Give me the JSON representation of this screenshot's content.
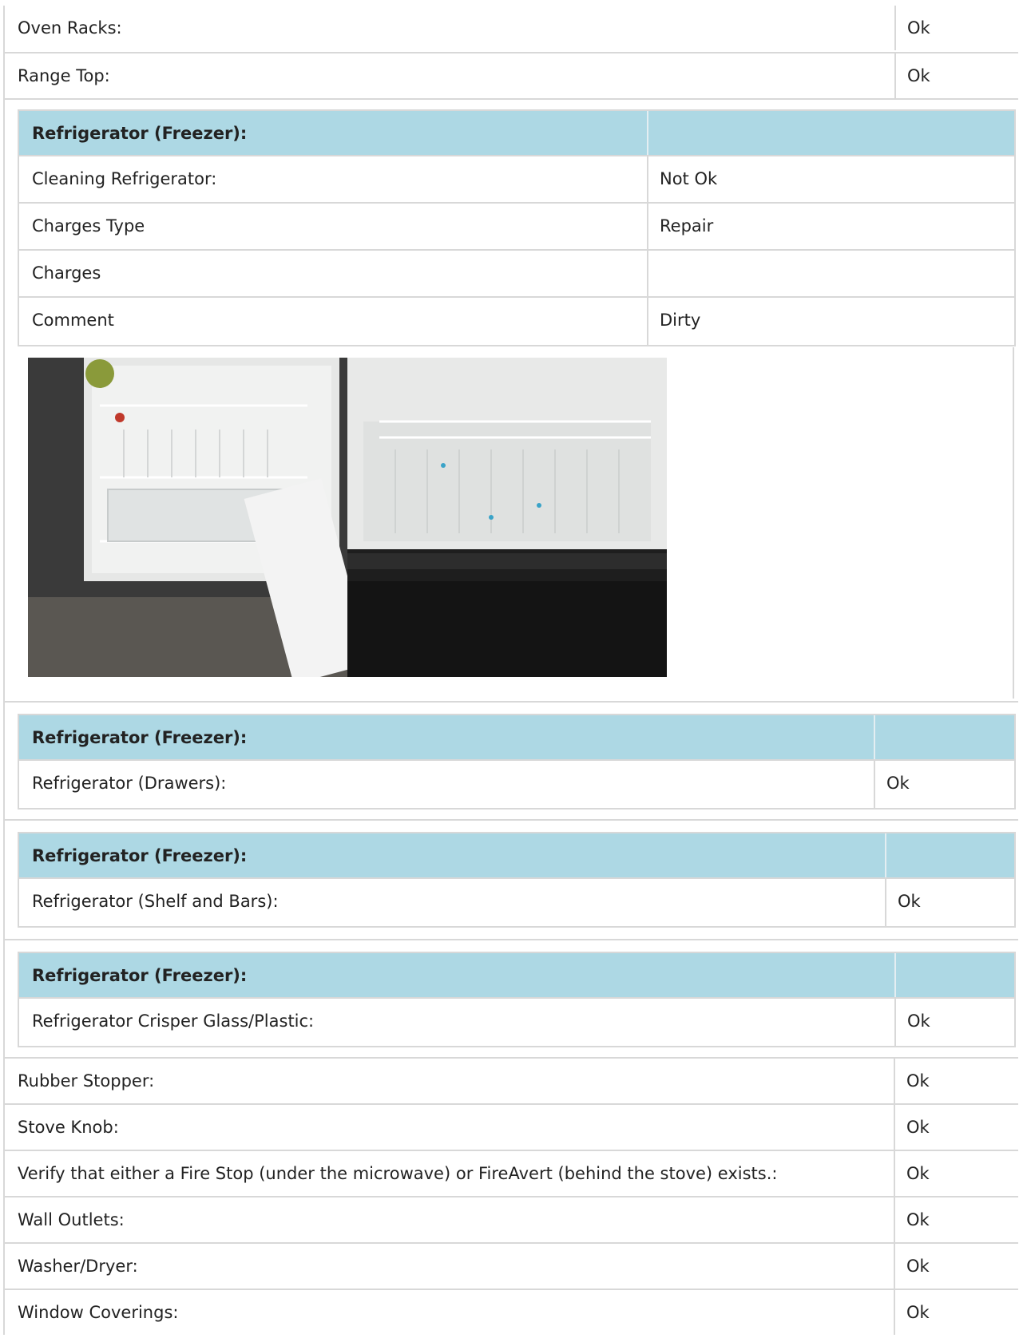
{
  "rows_top": [
    {
      "label": "Oven Racks:",
      "value": "Ok"
    },
    {
      "label": "Range Top:",
      "value": "Ok"
    }
  ],
  "group1": {
    "title": "Refrigerator (Freezer):",
    "rows": [
      {
        "label": "Cleaning Refrigerator:",
        "value": "Not Ok"
      },
      {
        "label": "Charges Type",
        "value": "Repair"
      },
      {
        "label": "Charges",
        "value": ""
      },
      {
        "label": "Comment",
        "value": "Dirty"
      }
    ]
  },
  "group2": {
    "title": "Refrigerator (Freezer):",
    "rows": [
      {
        "label": "Refrigerator (Drawers):",
        "value": "Ok"
      }
    ]
  },
  "group3": {
    "title": "Refrigerator (Freezer):",
    "rows": [
      {
        "label": "Refrigerator (Shelf and Bars):",
        "value": "Ok"
      }
    ]
  },
  "group4": {
    "title": "Refrigerator (Freezer):",
    "rows": [
      {
        "label": "Refrigerator Crisper Glass/Plastic:",
        "value": "Ok"
      }
    ]
  },
  "rows_bottom": [
    {
      "label": "Rubber Stopper:",
      "value": "Ok"
    },
    {
      "label": "Stove Knob:",
      "value": "Ok"
    },
    {
      "label": "Verify that either a Fire Stop (under the microwave) or FireAvert (behind the stove) exists.:",
      "value": "Ok"
    },
    {
      "label": "Wall Outlets:",
      "value": "Ok"
    },
    {
      "label": "Washer/Dryer:",
      "value": "Ok"
    },
    {
      "label": "Window Coverings:",
      "value": "Ok"
    }
  ]
}
